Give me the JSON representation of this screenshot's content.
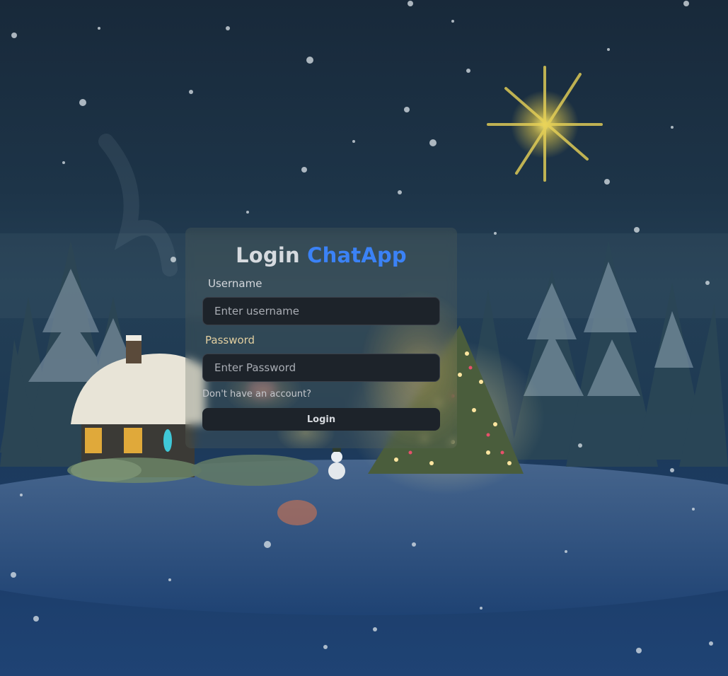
{
  "login": {
    "title_prefix": "Login",
    "title_brand": "ChatApp",
    "username_label": "Username",
    "username_placeholder": "Enter username",
    "password_label": "Password",
    "password_placeholder": "Enter Password",
    "signup_link": "Don't have an account?",
    "submit_label": "Login"
  },
  "colors": {
    "brand": "#3b82f6",
    "input_bg": "#1d232a",
    "button_bg": "#1d232a"
  }
}
